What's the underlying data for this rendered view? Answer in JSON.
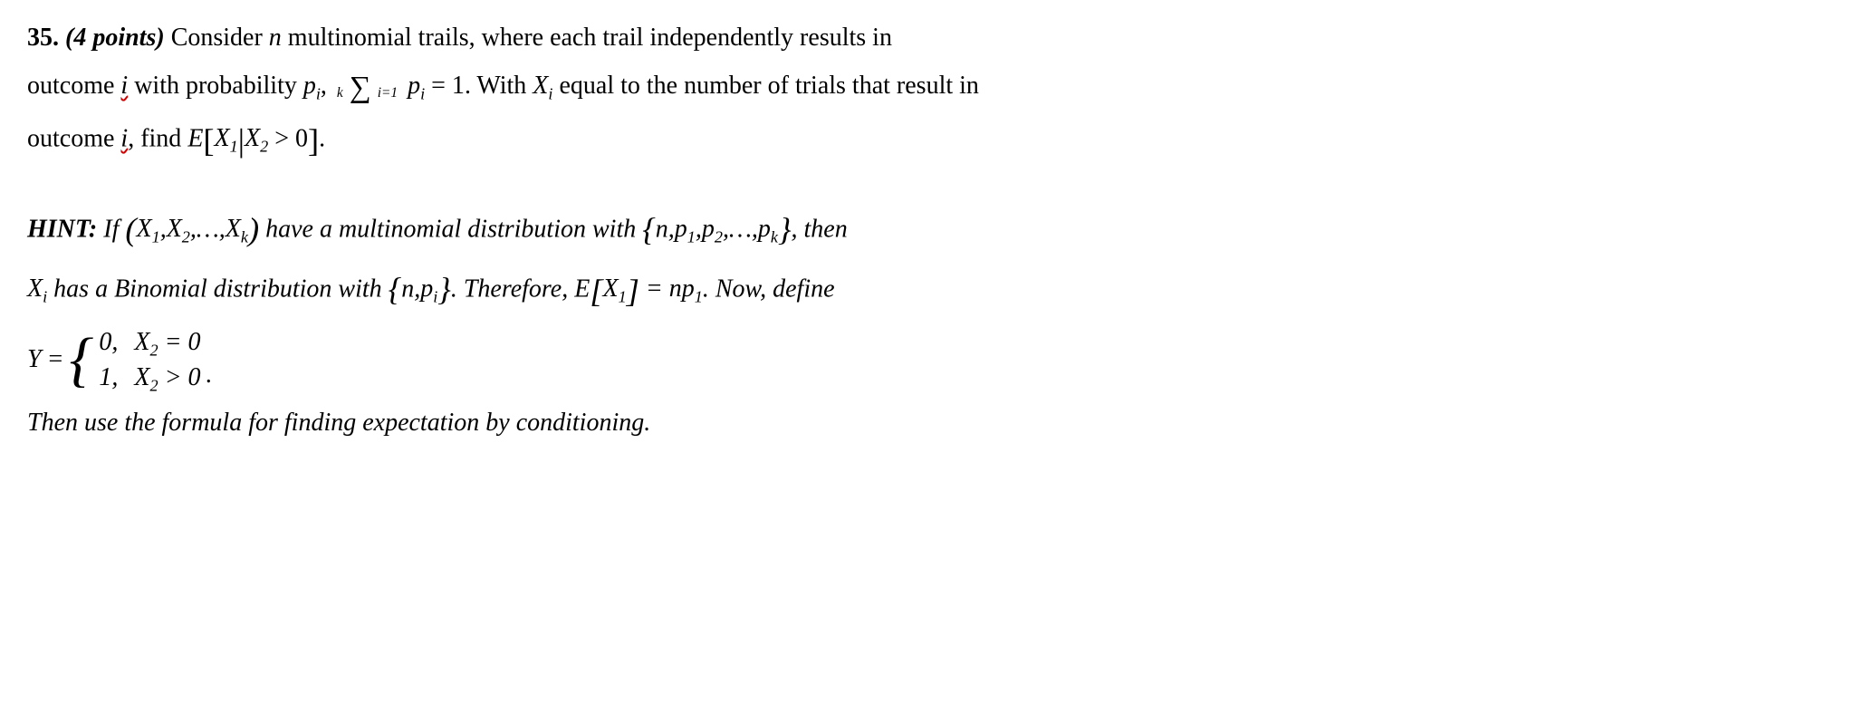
{
  "problem": {
    "number": "35.",
    "points_label": "(4 points)",
    "line1a": "Consider ",
    "nvar": "n",
    "line1b": " multinomial trails, where each trail independently results in",
    "line2a": "outcome ",
    "ivar": "i",
    "line2b": " with probability ",
    "p_i": "p",
    "line2c": ", ",
    "sum_top": "k",
    "sum_bot": "i=1",
    "sum_body_a": "p",
    "sum_body_b": " = 1",
    "line2d": ". With ",
    "Xi": "X",
    "line2e": " equal to the number of trials that result in",
    "line3a": "outcome ",
    "line3b": ", find ",
    "E_label": "E",
    "cond_content_a": "X",
    "cond_bar": "|",
    "cond_content_b": "X",
    "cond_gt": " > 0",
    "period": "."
  },
  "hint": {
    "label": "HINT:",
    "l1a": "If ",
    "tuple_open": "(",
    "X1": "X",
    "comma": ",",
    "X2": "X",
    "dots": ",…,",
    "Xk": "X",
    "tuple_close": ")",
    "l1b": " have a multinomial distribution with ",
    "set_open": "{",
    "nparam": "n",
    "p1": "p",
    "p2": "p",
    "pk": "p",
    "set_close": "}",
    "l1c": ", then",
    "l2a": " has a Binomial distribution with ",
    "npi_open": "{",
    "npi_n": "n",
    "npi_p": "p",
    "npi_close": "}",
    "l2b": ". Therefore, ",
    "EX1": "E",
    "EX1_in": "X",
    "eq_np1": " = np",
    "l2c": ". Now, define",
    "Yvar": "Y",
    "Yeq": " = ",
    "case0_v": "0,",
    "case0_c": "X",
    "case0_eq": " = 0",
    "case1_v": "1,",
    "case1_c": "X",
    "case1_eq": " > 0",
    "case_dot": ".",
    "l4": "Then use the formula for finding expectation by conditioning."
  }
}
